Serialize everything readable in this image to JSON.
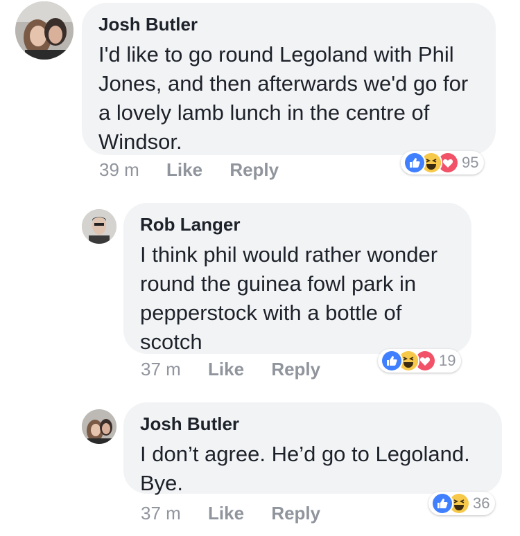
{
  "comments": [
    {
      "author": "Josh Butler",
      "text": "I'd like to go round Legoland with Phil Jones, and then afterwards we'd go for a lovely lamb lunch in the centre of Windsor.",
      "time": "39 m",
      "like_label": "Like",
      "reply_label": "Reply",
      "reaction_count": "95",
      "reactions": [
        "like-icon",
        "haha-icon",
        "love-icon"
      ]
    },
    {
      "author": "Rob Langer",
      "text": "I think phil would rather wonder round the guinea fowl park in pepperstock with a bottle of scotch",
      "time": "37 m",
      "like_label": "Like",
      "reply_label": "Reply",
      "reaction_count": "19",
      "reactions": [
        "like-icon",
        "haha-icon",
        "love-icon"
      ]
    },
    {
      "author": "Josh Butler",
      "text": "I don’t agree. He’d go to Legoland. Bye.",
      "time": "37 m",
      "like_label": "Like",
      "reply_label": "Reply",
      "reaction_count": "36",
      "reactions": [
        "like-icon",
        "haha-icon"
      ]
    }
  ],
  "colors": {
    "like": "#4080ff",
    "haha": "#f7c94a",
    "love": "#f25268",
    "bubble": "#f2f3f5",
    "meta": "#90949c"
  }
}
